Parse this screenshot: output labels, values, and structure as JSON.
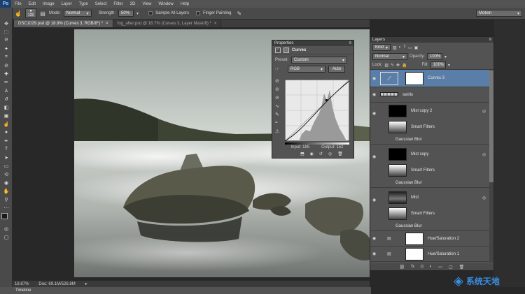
{
  "app": {
    "logo": "Ps"
  },
  "menu": [
    "File",
    "Edit",
    "Image",
    "Layer",
    "Type",
    "Select",
    "Filter",
    "3D",
    "View",
    "Window",
    "Help"
  ],
  "options": {
    "brush_size": "125",
    "mode_label": "Mode:",
    "mode_value": "Normal",
    "strength_label": "Strength:",
    "strength_value": "50%",
    "sample_all_layers": "Sample All Layers",
    "finger_painting": "Finger Painting",
    "workspace": "Motion"
  },
  "tabs": [
    {
      "label": "DSC1029.psd @ 18.9% (Curves 3, RGB/8*) *"
    },
    {
      "label": "fog_after.psd @ 16.7% (Curves 3, Layer Mask/8) *"
    }
  ],
  "status": {
    "zoom": "18.87%",
    "doc": "Doc: 69.1M/526.8M"
  },
  "timeline": {
    "label": "Timeline"
  },
  "properties": {
    "panel_title": "Properties",
    "adjustment": "Curves",
    "preset_label": "Preset:",
    "preset_value": "Custom",
    "channel": "RGB",
    "auto": "Auto",
    "input_label": "Input:",
    "input_value": "185",
    "output_label": "Output:",
    "output_value": "152"
  },
  "layers_panel": {
    "title": "Layers",
    "kind": "Kind",
    "blend": "Normal",
    "opacity_label": "Opacity:",
    "opacity_value": "100%",
    "lock_label": "Lock:",
    "fill_label": "Fill:",
    "fill_value": "100%",
    "layers": [
      {
        "name": "Curves 3"
      },
      {
        "name": "swirls"
      },
      {
        "name": "Mist copy 2"
      },
      {
        "name": "Smart Filters"
      },
      {
        "name": "Gaussian Blur"
      },
      {
        "name": "Mist copy"
      },
      {
        "name": "Smart Filters"
      },
      {
        "name": "Gaussian Blur"
      },
      {
        "name": "Mist"
      },
      {
        "name": "Smart Filters"
      },
      {
        "name": "Gaussian Blur"
      },
      {
        "name": "Hue/Saturation 2"
      },
      {
        "name": "Hue/Saturation 1"
      }
    ]
  },
  "watermark": {
    "text": "系统天地"
  },
  "colors": {
    "accent": "#5a7ea8",
    "panel": "#535353",
    "workspace": "#282828"
  },
  "icons": [
    "move-icon",
    "marquee-icon",
    "lasso-icon",
    "quick-select-icon",
    "crop-icon",
    "eyedropper-icon",
    "healing-icon",
    "brush-icon",
    "clone-stamp-icon",
    "history-brush-icon",
    "eraser-icon",
    "gradient-icon",
    "smudge-icon",
    "dodge-icon",
    "pen-icon",
    "type-icon",
    "path-select-icon",
    "shape-icon",
    "hand-icon",
    "zoom-icon"
  ]
}
